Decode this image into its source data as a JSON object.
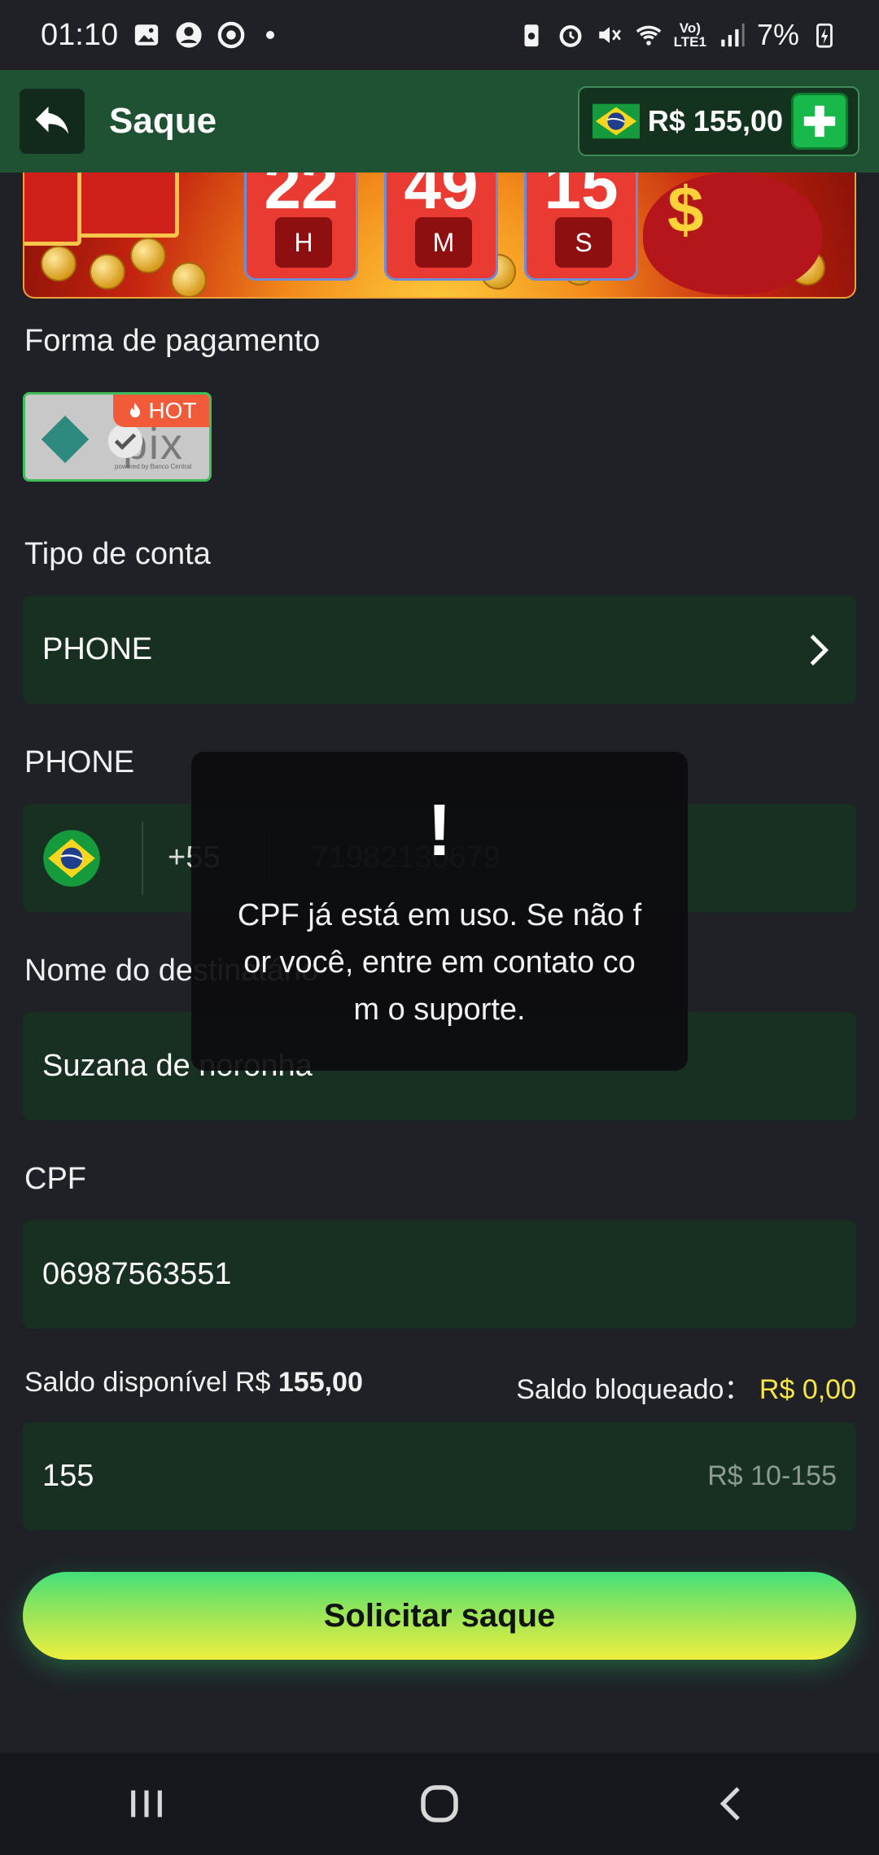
{
  "status_bar": {
    "time": "01:10",
    "battery": "7%",
    "lte_top": "Vo)",
    "lte_bottom": "LTE1"
  },
  "header": {
    "title": "Saque",
    "balance": "R$ 155,00",
    "back_icon": "back-arrow-icon",
    "add_icon": "plus-icon"
  },
  "banner": {
    "hours": "22",
    "minutes": "49",
    "seconds": "15",
    "hours_unit": "H",
    "minutes_unit": "M",
    "seconds_unit": "S"
  },
  "payment": {
    "label": "Forma de pagamento",
    "method": "pix",
    "method_sub": "powered by Banco Central",
    "badge": "HOT"
  },
  "account_type": {
    "label": "Tipo de conta",
    "value": "PHONE"
  },
  "phone": {
    "label": "PHONE",
    "country_code": "+55",
    "placeholder": "71982130679"
  },
  "recipient": {
    "label": "Nome do destinatário",
    "value": "Suzana de noronha"
  },
  "cpf": {
    "label": "CPF",
    "value": "06987563551"
  },
  "saldo": {
    "available_label": "Saldo disponível R$ ",
    "available_value": "155,00",
    "blocked_label": "Saldo bloqueado：",
    "blocked_value": "R$ 0,00"
  },
  "amount": {
    "value": "155",
    "hint": "R$ 10-155"
  },
  "submit": {
    "label": "Solicitar saque"
  },
  "toast": {
    "icon": "!",
    "message": "CPF já está em uso. Se não for você, entre em contato com o suporte."
  },
  "colors": {
    "header_bg": "#1e5233",
    "field_bg": "#173022",
    "accent_green": "#19b84a",
    "blocked_yellow": "#f5e54a"
  }
}
